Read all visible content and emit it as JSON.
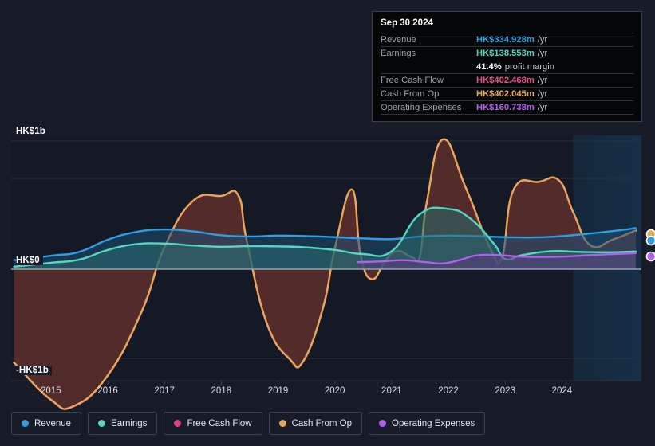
{
  "chart_data": {
    "type": "area",
    "title": "",
    "xlabel": "",
    "ylabel": "",
    "currency": "HK$",
    "ylim": [
      -1150,
      1150
    ],
    "y_ticks": [
      {
        "value": 1000,
        "label": "HK$1b"
      },
      {
        "value": 0,
        "label": "HK$0"
      },
      {
        "value": -1000,
        "label": "-HK$1b"
      }
    ],
    "grid": true,
    "legend_position": "bottom-left",
    "x_ticks": [
      "2015",
      "2016",
      "2017",
      "2018",
      "2019",
      "2020",
      "2021",
      "2022",
      "2023",
      "2024"
    ],
    "x_range": [
      2014.3,
      2025.4
    ],
    "forecast_start": "2024.2",
    "series": [
      {
        "name": "Revenue",
        "color": "#2e9fe0",
        "fill": "#1d4f77",
        "points": [
          [
            2014.35,
            70
          ],
          [
            2015.0,
            105
          ],
          [
            2015.5,
            135
          ],
          [
            2016.0,
            230
          ],
          [
            2016.5,
            290
          ],
          [
            2017.0,
            310
          ],
          [
            2017.5,
            295
          ],
          [
            2018.0,
            265
          ],
          [
            2018.5,
            255
          ],
          [
            2019.0,
            262
          ],
          [
            2019.5,
            258
          ],
          [
            2020.0,
            250
          ],
          [
            2020.5,
            240
          ],
          [
            2021.0,
            235
          ],
          [
            2021.5,
            255
          ],
          [
            2022.0,
            262
          ],
          [
            2022.5,
            258
          ],
          [
            2023.0,
            250
          ],
          [
            2023.5,
            248
          ],
          [
            2024.0,
            258
          ],
          [
            2024.75,
            290
          ],
          [
            2025.3,
            320
          ]
        ]
      },
      {
        "name": "Earnings",
        "color": "#55d6c2",
        "fill": "#2a6e70",
        "points": [
          [
            2014.35,
            20
          ],
          [
            2015.0,
            50
          ],
          [
            2015.5,
            75
          ],
          [
            2016.0,
            150
          ],
          [
            2016.5,
            195
          ],
          [
            2017.0,
            200
          ],
          [
            2017.5,
            185
          ],
          [
            2018.0,
            175
          ],
          [
            2018.5,
            180
          ],
          [
            2019.0,
            178
          ],
          [
            2019.5,
            170
          ],
          [
            2020.0,
            150
          ],
          [
            2020.5,
            118
          ],
          [
            2021.0,
            140
          ],
          [
            2021.5,
            430
          ],
          [
            2022.0,
            470
          ],
          [
            2022.4,
            390
          ],
          [
            2022.8,
            200
          ],
          [
            2023.0,
            80
          ],
          [
            2023.3,
            110
          ],
          [
            2023.8,
            140
          ],
          [
            2024.3,
            135
          ],
          [
            2024.8,
            132
          ],
          [
            2025.3,
            138
          ]
        ]
      },
      {
        "name": "Free Cash Flow",
        "color": "#d9427e",
        "fill": "#5c2033",
        "points": [
          [
            2014.35,
            -730
          ],
          [
            2015.0,
            -1020
          ],
          [
            2015.4,
            -1070
          ],
          [
            2016.0,
            -830
          ],
          [
            2016.6,
            -330
          ],
          [
            2017.0,
            170
          ],
          [
            2017.5,
            530
          ],
          [
            2018.0,
            570
          ],
          [
            2018.3,
            575
          ],
          [
            2018.45,
            215
          ],
          [
            2018.8,
            -420
          ],
          [
            2019.2,
            -700
          ],
          [
            2019.45,
            -715
          ],
          [
            2019.8,
            -290
          ],
          [
            2020.0,
            160
          ],
          [
            2020.3,
            620
          ],
          [
            2020.45,
            120
          ],
          [
            2020.65,
            -80
          ],
          [
            2020.9,
            70
          ],
          [
            2021.1,
            140
          ],
          [
            2021.35,
            95
          ],
          [
            2021.5,
            100
          ],
          [
            2021.62,
            520
          ],
          [
            2021.9,
            1010
          ],
          [
            2022.3,
            640
          ],
          [
            2022.75,
            150
          ],
          [
            2022.95,
            100
          ],
          [
            2023.15,
            620
          ],
          [
            2023.6,
            680
          ],
          [
            2023.95,
            690
          ],
          [
            2024.2,
            440
          ],
          [
            2024.5,
            185
          ],
          [
            2024.9,
            230
          ],
          [
            2025.3,
            300
          ]
        ]
      },
      {
        "name": "Cash From Op",
        "color": "#e8a85c",
        "fill": "#5e3429",
        "points": [
          [
            2014.35,
            -728
          ],
          [
            2015.0,
            -1018
          ],
          [
            2015.4,
            -1068
          ],
          [
            2016.0,
            -828
          ],
          [
            2016.6,
            -328
          ],
          [
            2017.0,
            172
          ],
          [
            2017.5,
            532
          ],
          [
            2018.0,
            572
          ],
          [
            2018.3,
            577
          ],
          [
            2018.45,
            217
          ],
          [
            2018.8,
            -418
          ],
          [
            2019.2,
            -698
          ],
          [
            2019.45,
            -713
          ],
          [
            2019.8,
            -288
          ],
          [
            2020.0,
            162
          ],
          [
            2020.3,
            622
          ],
          [
            2020.45,
            122
          ],
          [
            2020.65,
            -78
          ],
          [
            2020.9,
            72
          ],
          [
            2021.1,
            142
          ],
          [
            2021.35,
            97
          ],
          [
            2021.5,
            102
          ],
          [
            2021.62,
            522
          ],
          [
            2021.9,
            1012
          ],
          [
            2022.3,
            642
          ],
          [
            2022.75,
            152
          ],
          [
            2022.95,
            102
          ],
          [
            2023.15,
            622
          ],
          [
            2023.6,
            682
          ],
          [
            2023.95,
            692
          ],
          [
            2024.2,
            442
          ],
          [
            2024.5,
            187
          ],
          [
            2024.9,
            232
          ],
          [
            2025.3,
            302
          ]
        ]
      },
      {
        "name": "Operating Expenses",
        "color": "#b45ef0",
        "fill": "#5c3a80",
        "points": [
          [
            2020.4,
            55
          ],
          [
            2020.8,
            60
          ],
          [
            2021.2,
            70
          ],
          [
            2021.6,
            55
          ],
          [
            2021.9,
            45
          ],
          [
            2022.2,
            72
          ],
          [
            2022.5,
            108
          ],
          [
            2022.9,
            110
          ],
          [
            2023.2,
            100
          ],
          [
            2023.6,
            95
          ],
          [
            2024.0,
            98
          ],
          [
            2024.5,
            110
          ],
          [
            2024.9,
            118
          ],
          [
            2025.3,
            125
          ]
        ]
      }
    ],
    "endpoint_markers": [
      {
        "series": "Cash From Op",
        "color": "#e8a85c",
        "x": 816,
        "y": 294
      },
      {
        "series": "Revenue",
        "color": "#2e9fe0",
        "x": 816,
        "y": 302
      },
      {
        "series": "Operating Expenses",
        "color": "#b45ef0",
        "x": 816,
        "y": 322
      }
    ]
  },
  "tooltip": {
    "date": "Sep 30 2024",
    "unit": "/yr",
    "rows": [
      {
        "label": "Revenue",
        "value": "HK$334.928m",
        "color": "#2e9fe0"
      },
      {
        "label": "Earnings",
        "value": "HK$138.553m",
        "color": "#55d6c2"
      }
    ],
    "margin_row": {
      "value": "41.4%",
      "suffix": "profit margin"
    },
    "rows2": [
      {
        "label": "Free Cash Flow",
        "value": "HK$402.468m",
        "color": "#e8518a"
      },
      {
        "label": "Cash From Op",
        "value": "HK$402.045m",
        "color": "#e8a85c"
      },
      {
        "label": "Operating Expenses",
        "value": "HK$160.738m",
        "color": "#b45ef0"
      }
    ]
  },
  "legend": {
    "items": [
      {
        "label": "Revenue",
        "color": "#2e9fe0"
      },
      {
        "label": "Earnings",
        "color": "#55d6c2"
      },
      {
        "label": "Free Cash Flow",
        "color": "#d9427e"
      },
      {
        "label": "Cash From Op",
        "color": "#e8a85c"
      },
      {
        "label": "Operating Expenses",
        "color": "#b45ef0"
      }
    ]
  },
  "colors": {
    "page_background": "#171c28",
    "plot_background": "#141925",
    "gridline": "#2b3140",
    "zero_line": "#9aa0ab",
    "forecast_tint": "#18293a"
  }
}
